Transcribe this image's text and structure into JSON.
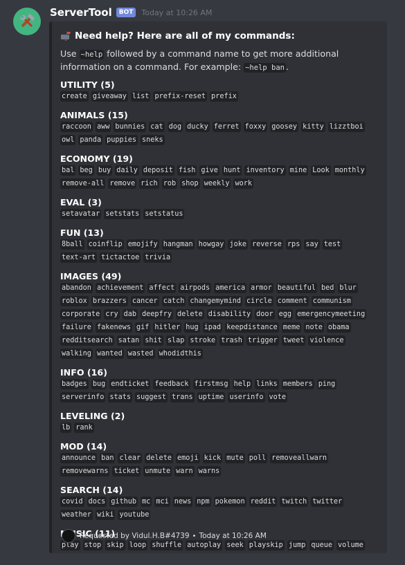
{
  "message": {
    "username": "ServerTool",
    "badge": "BOT",
    "timestamp": "Today at 10:26 AM",
    "avatar_icon": "tools-icon"
  },
  "embed": {
    "title": "Need help? Here are all of my commands:",
    "title_icon": "mailbox-icon",
    "description_prefix": "Use ",
    "description_cmd1": "~help",
    "description_middle": " followed by a command name to get more additional information on a command. For example: ",
    "description_cmd2": "~help ban",
    "description_suffix": ".",
    "fields": [
      {
        "name": "UTILITY (5)",
        "commands": [
          "create",
          "giveaway",
          "list",
          "prefix-reset",
          "prefix"
        ]
      },
      {
        "name": "ANIMALS (15)",
        "commands": [
          "raccoon",
          "aww",
          "bunnies",
          "cat",
          "dog",
          "ducky",
          "ferret",
          "foxxy",
          "goosey",
          "kitty",
          "lizztboi",
          "owl",
          "panda",
          "puppies",
          "sneks"
        ]
      },
      {
        "name": "ECONOMY (19)",
        "commands": [
          "bal",
          "beg",
          "buy",
          "daily",
          "deposit",
          "fish",
          "give",
          "hunt",
          "inventory",
          "mine",
          "Look",
          "monthly",
          "remove-all",
          "remove",
          "rich",
          "rob",
          "shop",
          "weekly",
          "work"
        ]
      },
      {
        "name": "EVAL (3)",
        "commands": [
          "setavatar",
          "setstats",
          "setstatus"
        ]
      },
      {
        "name": "FUN (13)",
        "commands": [
          "8ball",
          "coinflip",
          "emojify",
          "hangman",
          "howgay",
          "joke",
          "reverse",
          "rps",
          "say",
          "test",
          "text-art",
          "tictactoe",
          "trivia"
        ]
      },
      {
        "name": "IMAGES (49)",
        "commands": [
          "abandon",
          "achievement",
          "affect",
          "airpods",
          "america",
          "armor",
          "beautiful",
          "bed",
          "blur",
          "roblox",
          "brazzers",
          "cancer",
          "catch",
          "changemymind",
          "circle",
          "comment",
          "communism",
          "corporate",
          "cry",
          "dab",
          "deepfry",
          "delete",
          "disability",
          "door",
          "egg",
          "emergencymeeting",
          "failure",
          "fakenews",
          "gif",
          "hitler",
          "hug",
          "ipad",
          "keepdistance",
          "meme",
          "note",
          "obama",
          "redditsearch",
          "satan",
          "shit",
          "slap",
          "stroke",
          "trash",
          "trigger",
          "tweet",
          "violence",
          "walking",
          "wanted",
          "wasted",
          "whodidthis"
        ]
      },
      {
        "name": "INFO (16)",
        "commands": [
          "badges",
          "bug",
          "endticket",
          "feedback",
          "firstmsg",
          "help",
          "links",
          "members",
          "ping",
          "serverinfo",
          "stats",
          "suggest",
          "trans",
          "uptime",
          "userinfo",
          "vote"
        ]
      },
      {
        "name": "LEVELING (2)",
        "commands": [
          "lb",
          "rank"
        ]
      },
      {
        "name": "MOD (14)",
        "commands": [
          "announce",
          "ban",
          "clear",
          "delete",
          "emoji",
          "kick",
          "mute",
          "poll",
          "removeallwarn",
          "removewarns",
          "ticket",
          "unmute",
          "warn",
          "warns"
        ]
      },
      {
        "name": "SEARCH (14)",
        "commands": [
          "covid",
          "docs",
          "github",
          "mc",
          "mci",
          "news",
          "npm",
          "pokemon",
          "reddit",
          "twitch",
          "twitter",
          "weather",
          "wiki",
          "youtube"
        ]
      },
      {
        "name": "MUSIC (11)",
        "commands": [
          "play",
          "stop",
          "skip",
          "loop",
          "shuffle",
          "autoplay",
          "seek",
          "playskip",
          "jump",
          "queue",
          "volume"
        ]
      }
    ],
    "footer": {
      "text": "Requested by Vidul.H.B#4739",
      "separator": "•",
      "time": "Today at 10:26 AM"
    }
  }
}
